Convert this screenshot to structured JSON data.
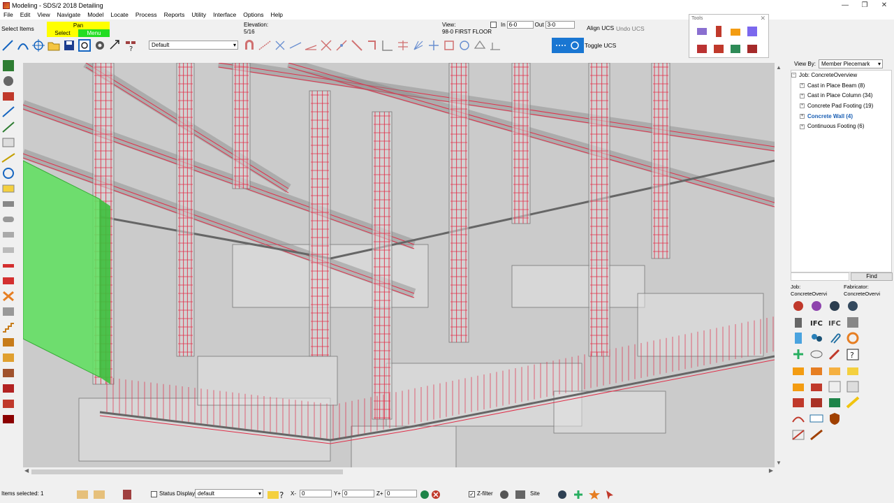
{
  "window": {
    "title": "Modeling - SDS/2 2018 Detailing",
    "controls": [
      "—",
      "❐",
      "✕"
    ]
  },
  "menu": [
    "File",
    "Edit",
    "View",
    "Navigate",
    "Model",
    "Locate",
    "Process",
    "Reports",
    "Utility",
    "Interface",
    "Options",
    "Help"
  ],
  "toolbar": {
    "select_items_label": "Select Items",
    "mouse_modes": {
      "pan": "Pan",
      "select": "Select",
      "menu": "Menu"
    },
    "elevation_label": "Elevation:",
    "elevation_value": "5/16",
    "view_label": "View:",
    "view_value": "98-0 FIRST FLOOR",
    "in_label": "In",
    "in_value": "6-0",
    "out_label": "Out",
    "out_value": "3-0",
    "align_ucs": "Align UCS",
    "undo_ucs": "Undo UCS",
    "toggle_ucs": "Toggle UCS",
    "layer_select": "Default"
  },
  "tools_panel": {
    "title": "Tools",
    "close": "✕"
  },
  "right_panel": {
    "view_by_label": "View By:",
    "view_by_value": "Member Piecemark",
    "tree": {
      "root": "Job: ConcreteOverview",
      "items": [
        {
          "label": "Cast in Place Beam (8)",
          "selected": false
        },
        {
          "label": "Cast in Place Column (34)",
          "selected": false
        },
        {
          "label": "Concrete Pad Footing (19)",
          "selected": false
        },
        {
          "label": "Concrete Wall (4)",
          "selected": true
        },
        {
          "label": "Continuous Footing (6)",
          "selected": false
        }
      ]
    },
    "find_label": "Find",
    "job_label": "Job:",
    "job_value": "ConcreteOvervi",
    "fabricator_label": "Fabricator:",
    "fabricator_value": "ConcreteOvervi"
  },
  "statusbar": {
    "items_selected": "Items selected: 1",
    "status_display_label": "Status Display",
    "status_display_value": "default",
    "x_label": "X-",
    "x_value": "0",
    "y_label": "Y+",
    "y_value": "0",
    "z_label": "Z+",
    "z_value": "0",
    "zfilter_label": "Z-filter",
    "site_label": "Site"
  },
  "colors": {
    "rebar": "#e0304a",
    "selected_wall": "#5ee05e",
    "pan_mode": "#ffff00",
    "menu_mode": "#22dd22",
    "tree_selected": "#1a5fb4"
  }
}
